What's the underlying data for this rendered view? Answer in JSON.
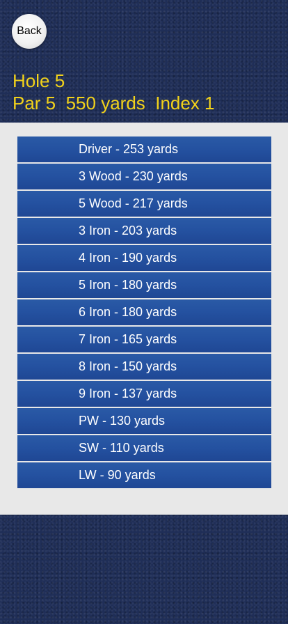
{
  "back_button": {
    "label": "Back"
  },
  "hole": {
    "title": "Hole 5",
    "details": "Par 5  550 yards  Index 1"
  },
  "clubs": [
    {
      "label": "Driver - 253 yards"
    },
    {
      "label": "3 Wood - 230 yards"
    },
    {
      "label": "5 Wood - 217 yards"
    },
    {
      "label": "3 Iron - 203 yards"
    },
    {
      "label": "4 Iron - 190 yards"
    },
    {
      "label": "5 Iron - 180 yards"
    },
    {
      "label": "6 Iron - 180 yards"
    },
    {
      "label": "7 Iron - 165 yards"
    },
    {
      "label": "8 Iron - 150 yards"
    },
    {
      "label": "9 Iron - 137 yards"
    },
    {
      "label": "PW - 130 yards"
    },
    {
      "label": "SW - 110 yards"
    },
    {
      "label": "LW - 90 yards"
    }
  ],
  "colors": {
    "header_text": "#f2d21a",
    "list_item_background": "#2451a0",
    "panel_background": "#e8e8e8",
    "page_background": "#1f2e57"
  }
}
